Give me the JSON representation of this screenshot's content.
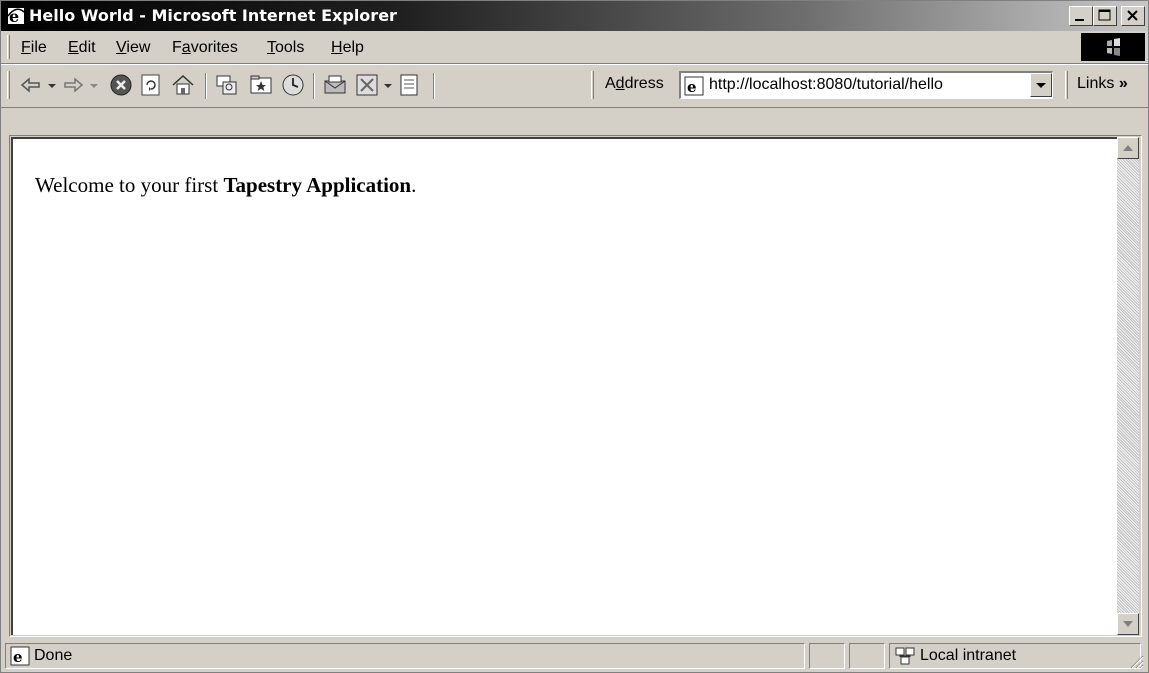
{
  "window": {
    "title": "Hello World - Microsoft Internet Explorer"
  },
  "menu": {
    "items": [
      {
        "label": "File",
        "accel": "F",
        "rest": "ile"
      },
      {
        "label": "Edit",
        "accel": "E",
        "rest": "dit"
      },
      {
        "label": "View",
        "accel": "V",
        "rest": "iew"
      },
      {
        "label": "Favorites",
        "pre": "F",
        "accel": "a",
        "rest": "vorites"
      },
      {
        "label": "Tools",
        "accel": "T",
        "rest": "ools"
      },
      {
        "label": "Help",
        "accel": "H",
        "rest": "elp"
      }
    ]
  },
  "toolbar": {
    "address_label_pre": "A",
    "address_label_accel": "d",
    "address_label_rest": "dress",
    "address_url": "http://localhost:8080/tutorial/hello",
    "links_label": "Links",
    "links_chevron": "»",
    "icons": [
      "back-icon",
      "forward-icon",
      "stop-icon",
      "refresh-icon",
      "home-icon",
      "search-icon",
      "favorites-icon",
      "history-icon",
      "print-icon",
      "edit-icon",
      "discuss-icon"
    ]
  },
  "content": {
    "welcome_pre": "Welcome to your first ",
    "welcome_bold": "Tapestry Application",
    "welcome_post": "."
  },
  "status": {
    "text": "Done",
    "zone": "Local intranet"
  }
}
